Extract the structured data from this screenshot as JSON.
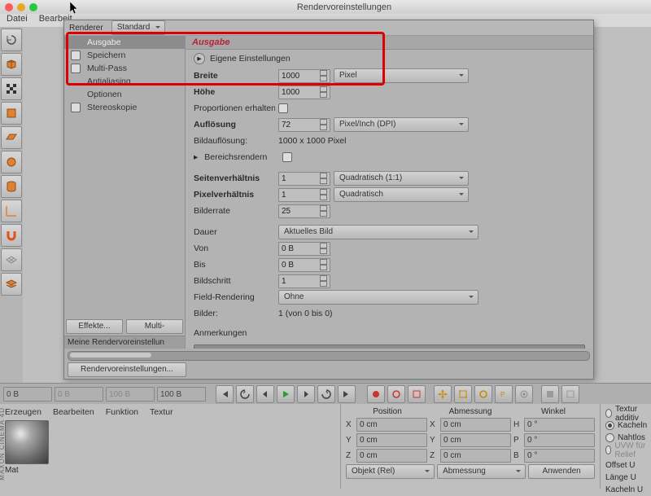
{
  "window": {
    "title": "Rendervoreinstellungen"
  },
  "menu": {
    "datei": "Datei",
    "bearb": "Bearbeit"
  },
  "dlg": {
    "renderer_lbl": "Renderer",
    "renderer_val": "Standard",
    "side": {
      "ausgabe": "Ausgabe",
      "speichern": "Speichern",
      "multipass": "Multi-Pass",
      "antialias": "Antialiasing",
      "optionen": "Optionen",
      "stereo": "Stereoskopie"
    },
    "effekte": "Effekte...",
    "multipass_btn": "Multi-Pass...",
    "myrender": "Meine Rendervoreinstellun",
    "footer_btn": "Rendervoreinstellungen...",
    "sec": "Ausgabe",
    "eigene": "Eigene Einstellungen",
    "breite": "Breite",
    "breite_v": "1000",
    "hoehe": "Höhe",
    "hoehe_v": "1000",
    "px_unit": "Pixel",
    "prop": "Proportionen erhalten",
    "aufl": "Auflösung",
    "aufl_v": "72",
    "aufl_unit": "Pixel/Inch (DPI)",
    "bildauf": "Bildauflösung:",
    "bildauf_v": "1000 x 1000 Pixel",
    "bereich": "Bereichsrendern",
    "seit": "Seitenverhältnis",
    "seit_v": "1",
    "seit_opt": "Quadratisch (1:1)",
    "pixv": "Pixelverhältnis",
    "pixv_v": "1",
    "pixv_opt": "Quadratisch",
    "bildr": "Bilderrate",
    "bildr_v": "25",
    "dauer": "Dauer",
    "dauer_v": "Aktuelles Bild",
    "von": "Von",
    "von_v": "0 B",
    "bis": "Bis",
    "bis_v": "0 B",
    "bilds": "Bildschritt",
    "bilds_v": "1",
    "fieldr": "Field-Rendering",
    "fieldr_v": "Ohne",
    "bilder": "Bilder:",
    "bilder_v": "1 (von 0 bis 0)",
    "anm": "Anmerkungen"
  },
  "bbar": {
    "f1": "0 B",
    "f2": "0 B",
    "f3": "100 B",
    "f4": "100 B"
  },
  "lower": {
    "tabs": {
      "erzeugen": "Erzeugen",
      "bearbeiten": "Bearbeiten",
      "funktion": "Funktion",
      "textur": "Textur"
    },
    "mat": "Mat",
    "hdr": {
      "pos": "Position",
      "abm": "Abmessung",
      "wink": "Winkel"
    },
    "rows": [
      {
        "a": "X",
        "p": "0 cm",
        "d": "0 cm",
        "wlab": "H",
        "w": "0 °"
      },
      {
        "a": "Y",
        "p": "0 cm",
        "d": "0 cm",
        "wlab": "P",
        "w": "0 °"
      },
      {
        "a": "Z",
        "p": "0 cm",
        "d": "0 cm",
        "wlab": "B",
        "w": "0 °"
      }
    ],
    "objekt": "Objekt (Rel)",
    "abm_btn": "Abmessung",
    "anw": "Anwenden",
    "opts": {
      "tex": "Textur additiv",
      "kach": "Kacheln",
      "naht": "Nahtlos",
      "uvw": "UVW für Relief",
      "offu": "Offset U",
      "lenu": "Länge U",
      "kachu": "Kacheln U"
    }
  }
}
